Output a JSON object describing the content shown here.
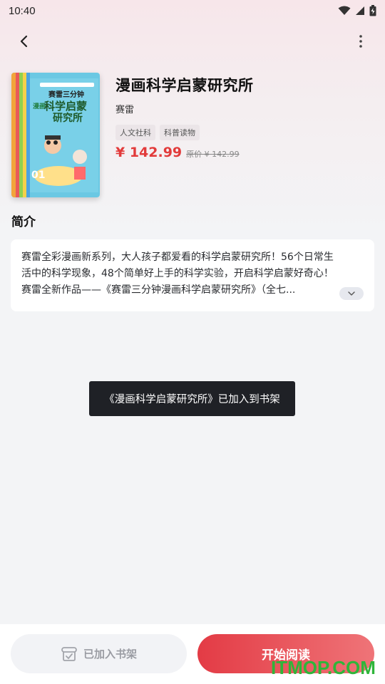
{
  "status": {
    "time": "10:40"
  },
  "book": {
    "title": "漫画科学启蒙研究所",
    "author": "赛雷",
    "tags": [
      "人文社科",
      "科普读物"
    ],
    "price": "¥ 142.99",
    "original_price": "原价 ¥ 142.99",
    "cover_text": {
      "top": "赛雷三分钟",
      "main1": "科学启蒙",
      "main2": "研究所",
      "side": "漫画",
      "vol": "01"
    }
  },
  "intro": {
    "heading": "简介",
    "line1": "赛雷全彩漫画新系列，大人孩子都爱看的科学启蒙研究所！56个日常生",
    "line2": "活中的科学现象，48个简单好上手的科学实验，开启科学启蒙好奇心！",
    "line3": "赛雷全新作品——《赛雷三分钟漫画科学启蒙研究所》（全七..."
  },
  "toast": "《漫画科学启蒙研究所》已加入到书架",
  "bottom": {
    "shelf_label": "已加入书架",
    "read_label": "开始阅读"
  },
  "watermark": "ITMOP.COM",
  "colors": {
    "price": "#e23b3b",
    "read_button_start": "#e33b45",
    "read_button_end": "#ef7478",
    "watermark": "#2fb53a"
  },
  "icons": [
    "wifi-icon",
    "signal-icon",
    "battery-icon",
    "back-arrow-icon",
    "more-vert-icon",
    "chevron-down-icon",
    "bookshelf-icon"
  ]
}
